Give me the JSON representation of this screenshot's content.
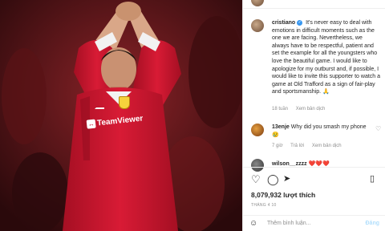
{
  "post": {
    "author": "cristiano",
    "caption": "It's never easy to deal with emotions in difficult moments such as the one we are facing. Nevertheless, we always have to be respectful, patient and set the example for all the youngsters who love the beautiful game. I would like to apologize for my outburst and, if possible, I would like to invite this supporter to watch a game at Old Trafford as a sign of fair-play and sportsmanship.",
    "caption_emoji": "🙏",
    "time": "18 tuần",
    "see_translation": "Xem bản dịch",
    "likes": "8,079,932 lượt thích",
    "date": "THÁNG 4 10"
  },
  "photo": {
    "sponsor_text": "TeamViewer",
    "club_badge": "manchester-united-crest"
  },
  "comments": [
    {
      "user": "13enje",
      "text": "Why did you smash my phone",
      "emoji": "😢",
      "time": "7 giờ",
      "reply": "Trả lời",
      "translate": "Xem bản dịch"
    },
    {
      "user": "wilson__zzzz",
      "text": "❤️❤️❤️"
    }
  ],
  "composer": {
    "placeholder": "Thêm bình luận...",
    "post_label": "Đăng"
  },
  "colors": {
    "accent": "#3897f0",
    "jersey": "#c8102e"
  }
}
